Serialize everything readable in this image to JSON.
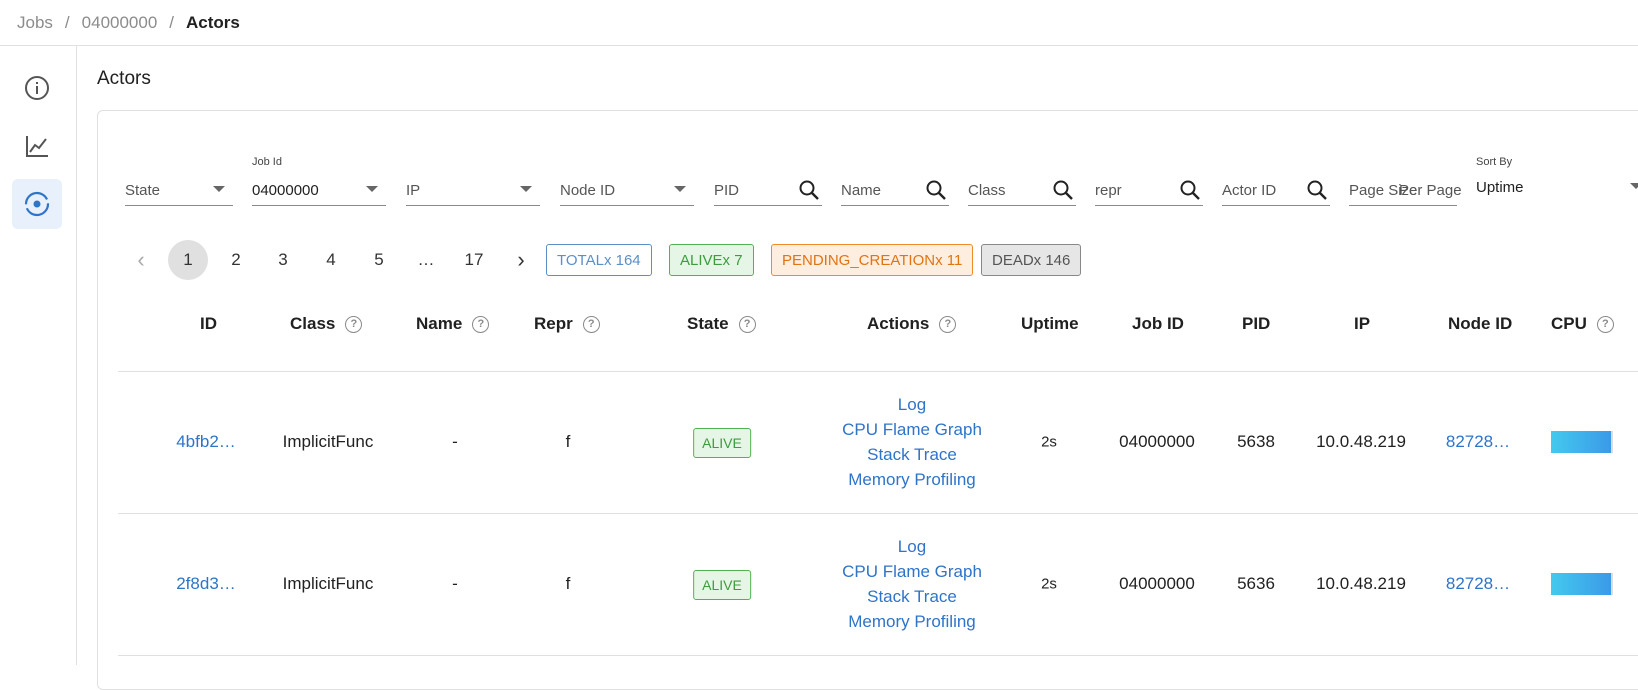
{
  "breadcrumb": {
    "items": [
      "Jobs",
      "04000000"
    ],
    "separator": "/",
    "current": "Actors"
  },
  "nav": {
    "icons": [
      "info-icon",
      "chart-icon",
      "actor-icon"
    ],
    "active": "actor-icon"
  },
  "page_title": "Actors",
  "filters": {
    "state": {
      "placeholder": "State"
    },
    "job_id": {
      "label": "Job Id",
      "value": "04000000"
    },
    "ip": {
      "placeholder": "IP"
    },
    "node_id": {
      "placeholder": "Node ID"
    },
    "pid": {
      "placeholder": "PID"
    },
    "name": {
      "placeholder": "Name"
    },
    "class": {
      "placeholder": "Class"
    },
    "repr": {
      "placeholder": "repr"
    },
    "actor_id": {
      "placeholder": "Actor ID"
    },
    "page_size": {
      "placeholder": "Page Size",
      "overlap": "Per Page"
    },
    "sort_by": {
      "label": "Sort By",
      "value": "Uptime"
    }
  },
  "pagination": {
    "prev": "‹",
    "pages": [
      "1",
      "2",
      "3",
      "4",
      "5",
      "…",
      "17"
    ],
    "current": "1",
    "next": "›"
  },
  "state_chips": {
    "total": "TOTALx 164",
    "alive": "ALIVEx 7",
    "pending": "PENDING_CREATIONx 11",
    "dead": "DEADx 146"
  },
  "table": {
    "columns": [
      "ID",
      "Class",
      "Name",
      "Repr",
      "State",
      "Actions",
      "Uptime",
      "Job ID",
      "PID",
      "IP",
      "Node ID",
      "CPU"
    ],
    "help_glyph": "?",
    "rows": [
      {
        "id": "4bfb2…",
        "class": "ImplicitFunc",
        "name": "-",
        "repr": "f",
        "state": "ALIVE",
        "actions": [
          "Log",
          "CPU Flame Graph",
          "Stack Trace",
          "Memory Profiling"
        ],
        "uptime": "2s",
        "job_id": "04000000",
        "pid": "5638",
        "ip": "10.0.48.219",
        "node_id": "82728…"
      },
      {
        "id": "2f8d3…",
        "class": "ImplicitFunc",
        "name": "-",
        "repr": "f",
        "state": "ALIVE",
        "actions": [
          "Log",
          "CPU Flame Graph",
          "Stack Trace",
          "Memory Profiling"
        ],
        "uptime": "2s",
        "job_id": "04000000",
        "pid": "5636",
        "ip": "10.0.48.219",
        "node_id": "82728…"
      }
    ]
  },
  "colors": {
    "link": "#2e74c9",
    "alive": "#3d9c3d",
    "pending": "#e07411",
    "total": "#5b8fc7",
    "cpu_bar": "#43c9ee"
  }
}
